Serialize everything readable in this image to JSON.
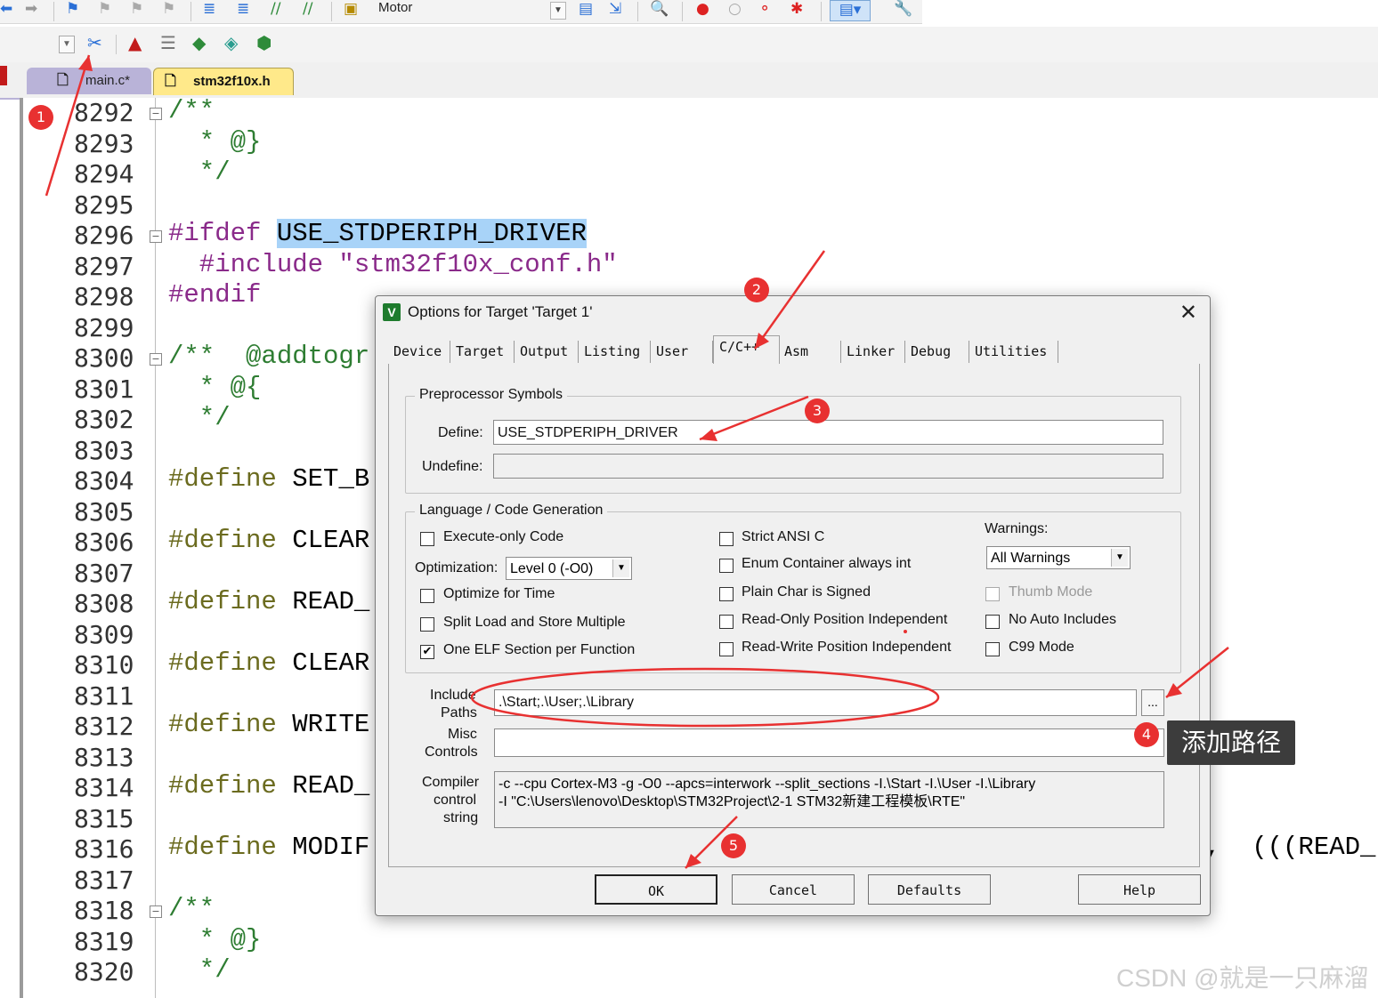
{
  "toolbar": {
    "target_name": "Motor"
  },
  "tabs": [
    {
      "label": "main.c*"
    },
    {
      "label": "stm32f10x.h"
    }
  ],
  "editor": {
    "lines": [
      {
        "num": "8292",
        "code": "/**"
      },
      {
        "num": "8293",
        "code": "  * @}"
      },
      {
        "num": "8294",
        "code": "  */"
      },
      {
        "num": "8295",
        "code": ""
      },
      {
        "num": "8296",
        "code_prefix": "#ifdef ",
        "code_highlight": "USE_STDPERIPH_DRIVER"
      },
      {
        "num": "8297",
        "code": "  #include \"stm32f10x_conf.h\""
      },
      {
        "num": "8298",
        "code": "#endif"
      },
      {
        "num": "8299",
        "code": ""
      },
      {
        "num": "8300",
        "code": "/**  @addtogr"
      },
      {
        "num": "8301",
        "code": "  * @{"
      },
      {
        "num": "8302",
        "code": "  */"
      },
      {
        "num": "8303",
        "code": ""
      },
      {
        "num": "8304",
        "code_kw": "#define",
        "code_rest": " SET_B"
      },
      {
        "num": "8305",
        "code": ""
      },
      {
        "num": "8306",
        "code_kw": "#define",
        "code_rest": " CLEAR"
      },
      {
        "num": "8307",
        "code": ""
      },
      {
        "num": "8308",
        "code_kw": "#define",
        "code_rest": " READ_"
      },
      {
        "num": "8309",
        "code": ""
      },
      {
        "num": "8310",
        "code_kw": "#define",
        "code_rest": " CLEAR"
      },
      {
        "num": "8311",
        "code": ""
      },
      {
        "num": "8312",
        "code_kw": "#define",
        "code_rest": " WRITE"
      },
      {
        "num": "8313",
        "code": ""
      },
      {
        "num": "8314",
        "code_kw": "#define",
        "code_rest": " READ_"
      },
      {
        "num": "8315",
        "code": ""
      },
      {
        "num": "8316",
        "code_kw": "#define",
        "code_rest": " MODIF",
        "code_tail": ",  (((READ_"
      },
      {
        "num": "8317",
        "code": ""
      },
      {
        "num": "8318",
        "code": "/**"
      },
      {
        "num": "8319",
        "code": "  * @}"
      },
      {
        "num": "8320",
        "code": "  */"
      }
    ]
  },
  "dialog": {
    "title": "Options for Target 'Target 1'",
    "close": "✕",
    "tabs": [
      "Device",
      "Target",
      "Output",
      "Listing",
      "User",
      "C/C++",
      "Asm",
      "Linker",
      "Debug",
      "Utilities"
    ],
    "active_tab": "C/C++",
    "preprocessor": {
      "group_title": "Preprocessor Symbols",
      "define_label": "Define:",
      "define_value": "USE_STDPERIPH_DRIVER",
      "undefine_label": "Undefine:",
      "undefine_value": ""
    },
    "language": {
      "group_title": "Language / Code Generation",
      "execute_only": {
        "label": "Execute-only Code",
        "checked": false
      },
      "optimization_label": "Optimization:",
      "optimization_value": "Level 0 (-O0)",
      "optimize_time": {
        "label": "Optimize for Time",
        "checked": false
      },
      "split_load": {
        "label": "Split Load and Store Multiple",
        "checked": false
      },
      "one_elf": {
        "label": "One ELF Section per Function",
        "checked": true
      },
      "strict_ansi": {
        "label": "Strict ANSI C",
        "checked": false
      },
      "enum_container": {
        "label": "Enum Container always int",
        "checked": false
      },
      "plain_char": {
        "label": "Plain Char is Signed",
        "checked": false
      },
      "ro_pi": {
        "label": "Read-Only Position Independent",
        "checked": false
      },
      "rw_pi": {
        "label": "Read-Write Position Independent",
        "checked": false
      },
      "warnings_label": "Warnings:",
      "warnings_value": "All Warnings",
      "thumb_mode": {
        "label": "Thumb Mode",
        "checked": false
      },
      "no_auto_includes": {
        "label": "No Auto Includes",
        "checked": false
      },
      "c99_mode": {
        "label": "C99 Mode",
        "checked": false
      }
    },
    "include_paths_label_1": "Include",
    "include_paths_label_2": "Paths",
    "include_paths_value": ".\\Start;.\\User;.\\Library",
    "browse_label": "...",
    "misc_label_1": "Misc",
    "misc_label_2": "Controls",
    "misc_value": "",
    "compiler_label_1": "Compiler",
    "compiler_label_2": "control",
    "compiler_label_3": "string",
    "compiler_line_1": "-c --cpu Cortex-M3 -g -O0 --apcs=interwork --split_sections -I.\\Start -I.\\User -I.\\Library",
    "compiler_line_2": "-I \"C:\\Users\\lenovo\\Desktop\\STM32Project\\2-1 STM32新建工程模板\\RTE\"",
    "buttons": {
      "ok": "OK",
      "cancel": "Cancel",
      "defaults": "Defaults",
      "help": "Help"
    }
  },
  "annotations": {
    "badges": [
      "1",
      "2",
      "3",
      "4",
      "5"
    ],
    "tooltip": "添加路径",
    "color": "#e83131"
  },
  "watermark": "CSDN @就是一只麻溜"
}
